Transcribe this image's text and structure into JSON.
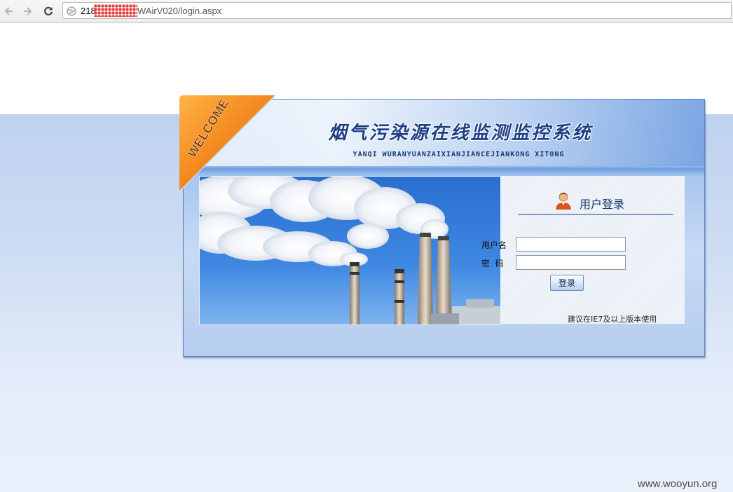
{
  "browser": {
    "url_host": "218",
    "url_path": "WAirV020/login.aspx"
  },
  "header": {
    "title_cn": "烟气污染源在线监测监控系统",
    "title_en": "YANQI WURANYUANZAIXIANJIANCEJIANKONG XITONG",
    "welcome_badge": "WELCOME"
  },
  "login": {
    "title": "用户登录",
    "username_label": "用户名",
    "password_label": "密  码",
    "username_value": "",
    "password_value": "",
    "submit_label": "登录",
    "browser_hint": "建议在IE7及以上版本使用"
  },
  "watermark": "www.wooyun.org",
  "colors": {
    "accent_blue": "#1c3f86",
    "badge_orange": "#f28a1e",
    "page_band": "#bed2ef"
  }
}
